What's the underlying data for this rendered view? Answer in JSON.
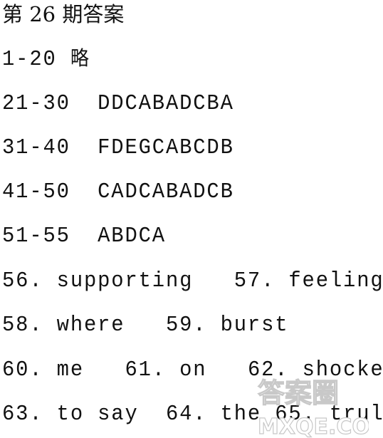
{
  "title": "第 26 期答案",
  "lines": [
    {
      "range": "1-20",
      "answer": "略"
    },
    {
      "range": "21-30",
      "answer": "DDCABADCBA"
    },
    {
      "range": "31-40",
      "answer": "FDEGCABCDB"
    },
    {
      "range": "41-50",
      "answer": "CADCABADCB"
    },
    {
      "range": "51-55",
      "answer": "ABDCA"
    }
  ],
  "fill_in": [
    [
      {
        "num": "56.",
        "word": "supporting"
      },
      {
        "num": "57.",
        "word": "feelings"
      }
    ],
    [
      {
        "num": "58.",
        "word": "where"
      },
      {
        "num": "59.",
        "word": "burst"
      }
    ],
    [
      {
        "num": "60.",
        "word": "me"
      },
      {
        "num": "61.",
        "word": "on"
      },
      {
        "num": "62.",
        "word": "shocked"
      }
    ],
    [
      {
        "num": "63.",
        "word": "to say"
      },
      {
        "num": "64.",
        "word": "the"
      },
      {
        "num": "65.",
        "word": "truly"
      }
    ]
  ],
  "watermark": {
    "top": "答案圈",
    "bottom": "MXQE.COM"
  }
}
